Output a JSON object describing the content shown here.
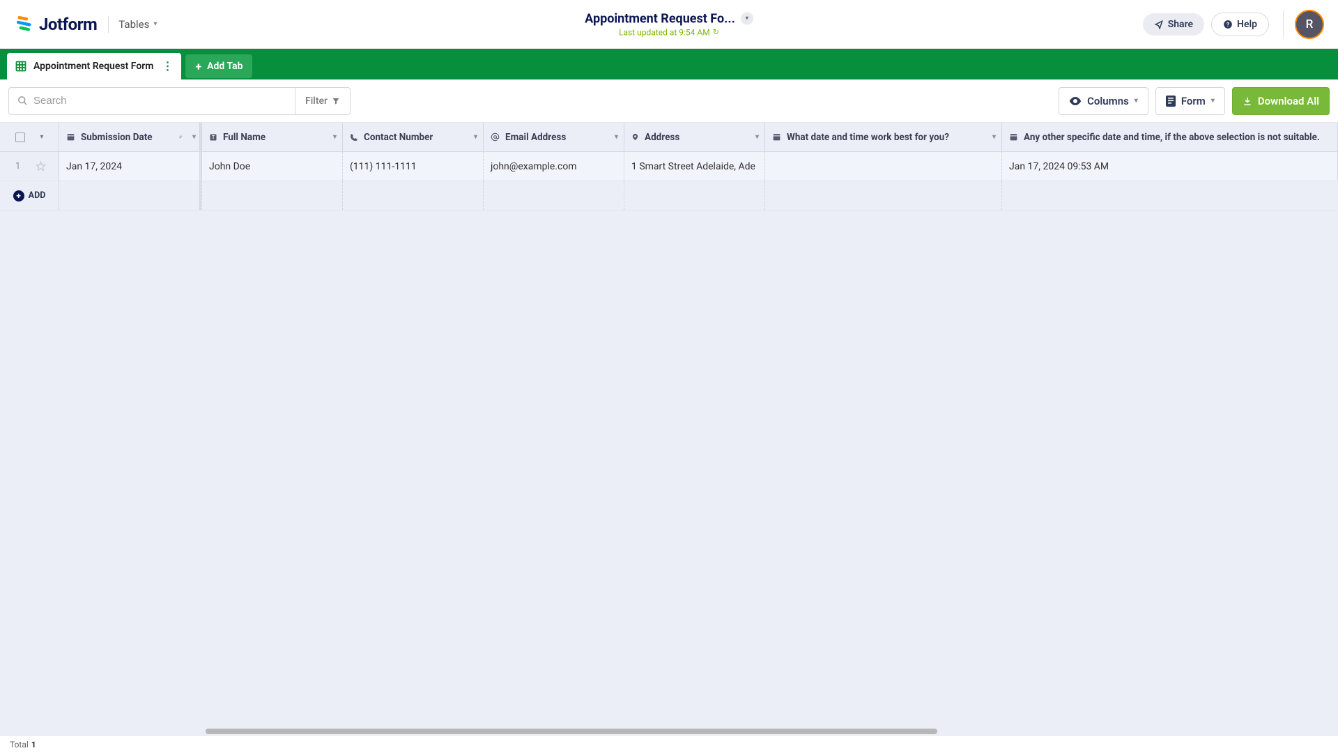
{
  "brand": {
    "name": "Jotform",
    "mode": "Tables"
  },
  "header": {
    "title": "Appointment Request Fo...",
    "last_updated": "Last updated at 9:54 AM",
    "share": "Share",
    "help": "Help",
    "avatar_initial": "R"
  },
  "tabs": {
    "active": "Appointment Request Form",
    "add": "Add Tab"
  },
  "toolbar": {
    "search_placeholder": "Search",
    "filter": "Filter",
    "columns": "Columns",
    "form": "Form",
    "download": "Download All"
  },
  "columns": {
    "submission_date": "Submission Date",
    "full_name": "Full Name",
    "contact_number": "Contact Number",
    "email": "Email Address",
    "address": "Address",
    "q_datetime": "What date and time work best for you?",
    "q_other": "Any other specific date and time, if the above selection is not suitable."
  },
  "rows": [
    {
      "n": "1",
      "submission_date": "Jan 17, 2024",
      "full_name": "John Doe",
      "contact_number": "(111) 111-1111",
      "email": "john@example.com",
      "address": "1 Smart Street  Adelaide, Ade",
      "q_datetime": "",
      "q_other": "Jan 17, 2024 09:53 AM"
    }
  ],
  "add_row": "ADD",
  "footer": {
    "total_label": "Total",
    "total_count": "1"
  }
}
